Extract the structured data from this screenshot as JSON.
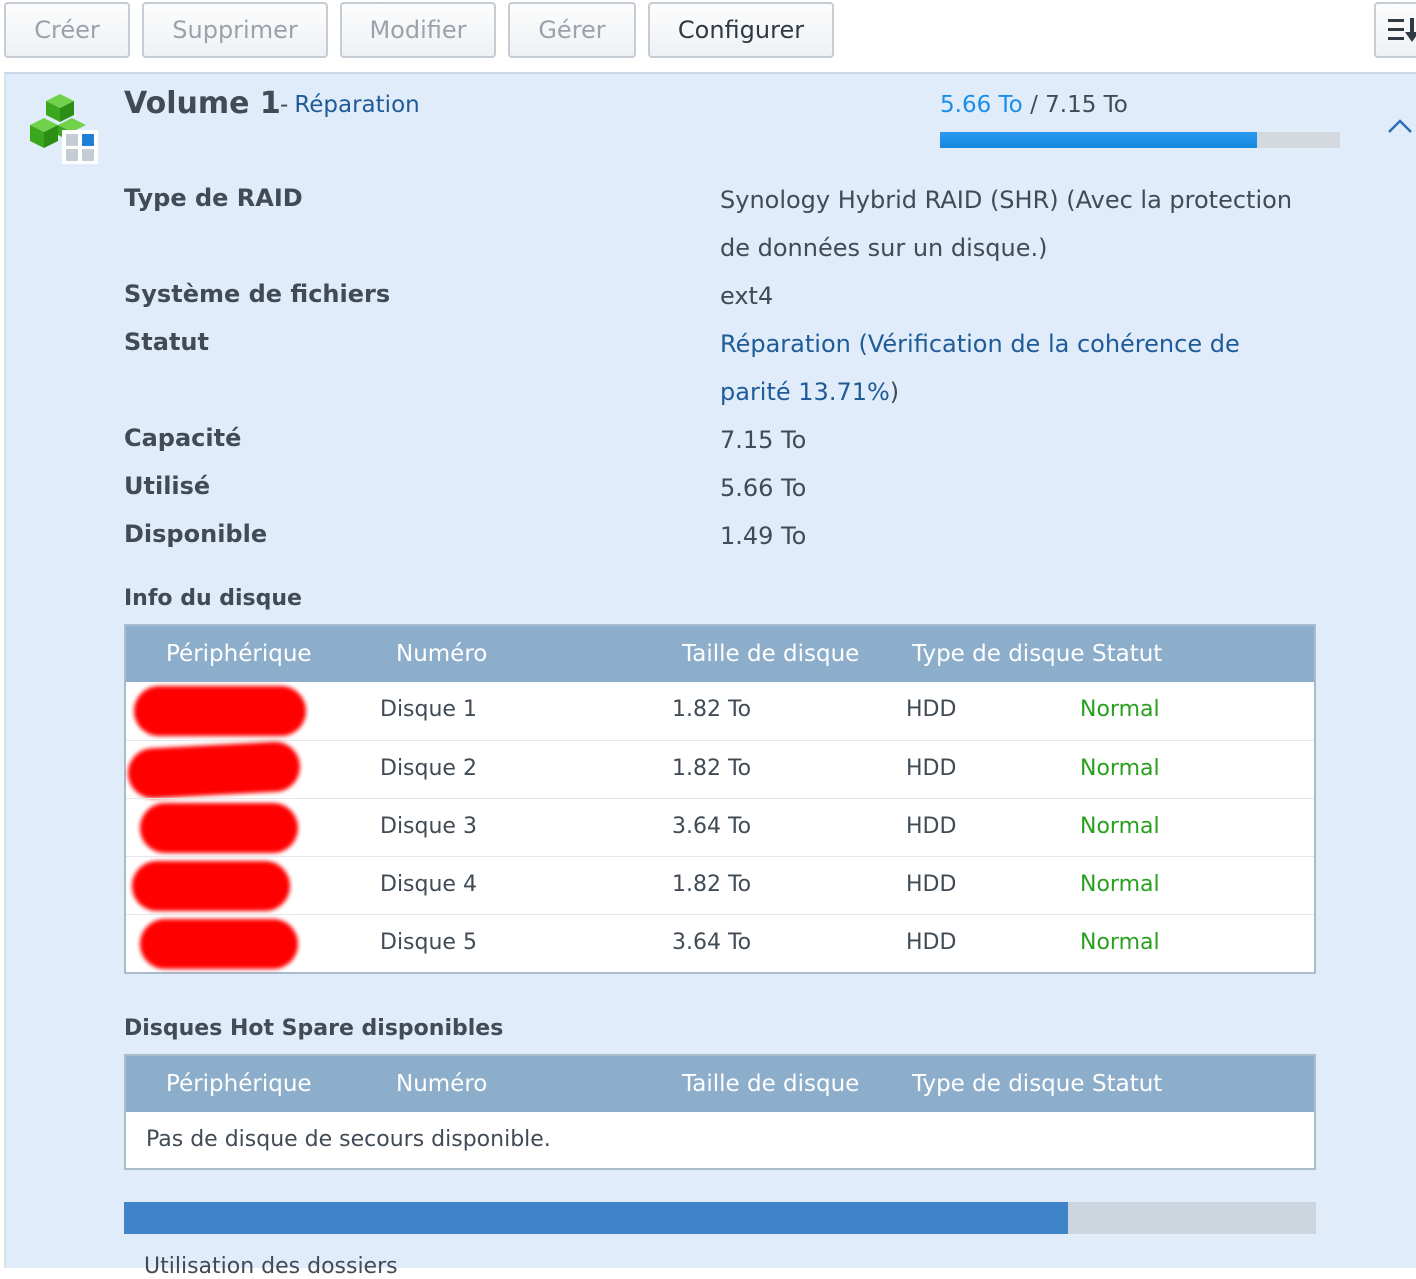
{
  "toolbar": {
    "buttons": [
      {
        "label": "Créer",
        "enabled": false
      },
      {
        "label": "Supprimer",
        "enabled": false
      },
      {
        "label": "Modifier",
        "enabled": false
      },
      {
        "label": "Gérer",
        "enabled": false
      },
      {
        "label": "Configurer",
        "enabled": true
      }
    ],
    "menu_icon": "list-sort-icon"
  },
  "volume": {
    "title": "Volume 1",
    "separator": "-",
    "state": "Réparation",
    "used": "5.66 To",
    "slash": "/",
    "total": "7.15 To",
    "usage_fraction": 0.7916,
    "collapse_icon": "chevron-up-icon",
    "icon": "volume-cubes-icon"
  },
  "details": [
    {
      "label": "Type de RAID",
      "value": "Synology Hybrid RAID (SHR) (Avec la protection de données sur un disque.)"
    },
    {
      "label": "Système de fichiers",
      "value": "ext4"
    },
    {
      "label": "Statut",
      "value_link": "Réparation (Vérification de la cohérence de parité 13.71%",
      "value_suffix": ")"
    },
    {
      "label": "Capacité",
      "value": "7.15 To"
    },
    {
      "label": "Utilisé",
      "value": "5.66 To"
    },
    {
      "label": "Disponible",
      "value": "1.49 To"
    }
  ],
  "disk_info": {
    "title": "Info du disque",
    "columns": [
      "Périphérique",
      "Numéro",
      "Taille de disque",
      "Type de disque",
      "Statut"
    ],
    "rows": [
      {
        "device": "",
        "number": "Disque 1",
        "size": "1.82 To",
        "type": "HDD",
        "status": "Normal"
      },
      {
        "device": "",
        "number": "Disque 2",
        "size": "1.82 To",
        "type": "HDD",
        "status": "Normal"
      },
      {
        "device": "",
        "number": "Disque 3",
        "size": "3.64 To",
        "type": "HDD",
        "status": "Normal"
      },
      {
        "device": "",
        "number": "Disque 4",
        "size": "1.82 To",
        "type": "HDD",
        "status": "Normal"
      },
      {
        "device": "",
        "number": "Disque 5",
        "size": "3.64 To",
        "type": "HDD",
        "status": "Normal"
      }
    ],
    "status_color": "#27a11d"
  },
  "hot_spare": {
    "title": "Disques Hot Spare disponibles",
    "columns": [
      "Périphérique",
      "Numéro",
      "Taille de disque",
      "Type de disque",
      "Statut"
    ],
    "empty_message": "Pas de disque de secours disponible."
  },
  "folder_usage": {
    "fraction": 0.7916,
    "label": "Utilisation des dossiers"
  },
  "colors": {
    "accent": "#1a8ee8",
    "link": "#1f5b98",
    "panel_bg": "#e0ecfa",
    "table_header": "#8daecb"
  }
}
